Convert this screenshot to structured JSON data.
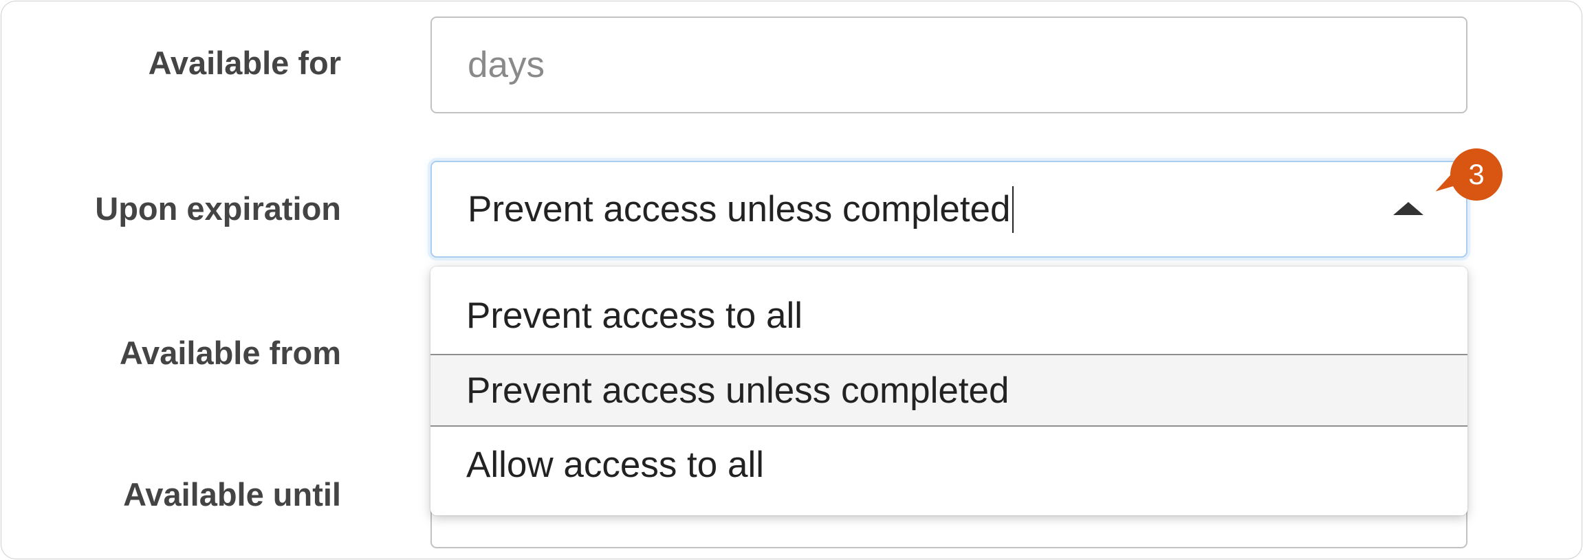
{
  "form": {
    "available_for": {
      "label": "Available for",
      "value": "",
      "placeholder": "days"
    },
    "upon_expiration": {
      "label": "Upon expiration",
      "selected": "Prevent access unless completed",
      "options": [
        "Prevent access to all",
        "Prevent access unless completed",
        "Allow access to all"
      ]
    },
    "available_from": {
      "label": "Available from"
    },
    "available_until": {
      "label": "Available until"
    }
  },
  "annotation": {
    "step_number": "3",
    "color": "#d85512"
  },
  "icons": {
    "dropdown_toggle": "chevron-up-icon"
  }
}
